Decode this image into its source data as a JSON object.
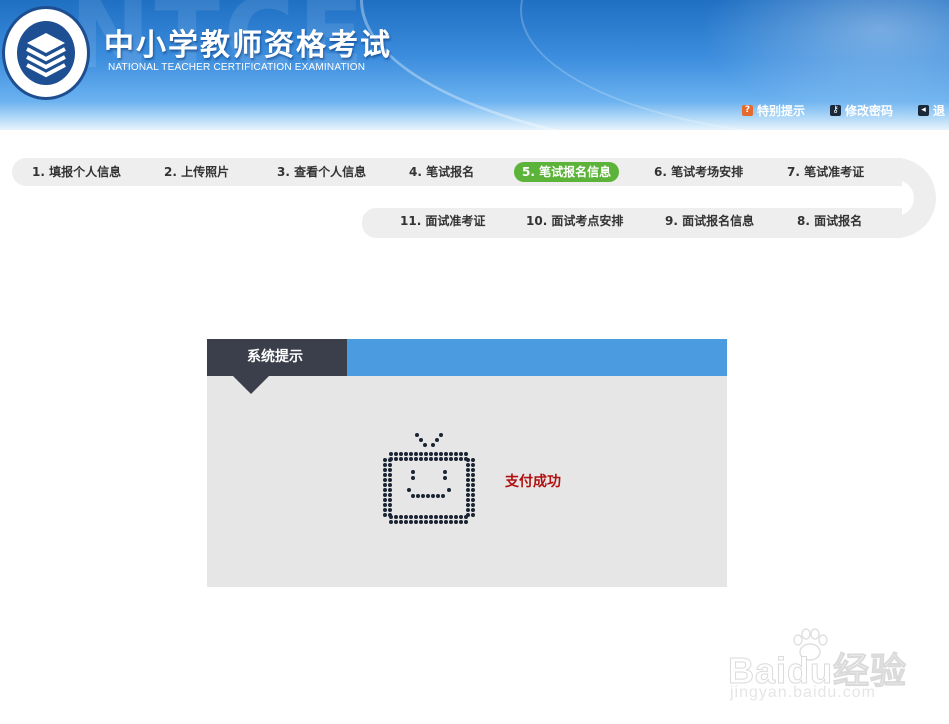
{
  "header": {
    "title": "中小学教师资格考试",
    "subtitle": "NATIONAL TEACHER CERTIFICATION EXAMINATION",
    "watermark_letters": "NTCE",
    "links": [
      {
        "icon": "warning-icon",
        "label": "特别提示"
      },
      {
        "icon": "key-icon",
        "label": "修改密码"
      },
      {
        "icon": "exit-icon",
        "label": "退"
      }
    ]
  },
  "steps": [
    {
      "label": "1. 填报个人信息",
      "active": false
    },
    {
      "label": "2. 上传照片",
      "active": false
    },
    {
      "label": "3. 查看个人信息",
      "active": false
    },
    {
      "label": "4. 笔试报名",
      "active": false
    },
    {
      "label": "5. 笔试报名信息",
      "active": true
    },
    {
      "label": "6. 笔试考场安排",
      "active": false
    },
    {
      "label": "7. 笔试准考证",
      "active": false
    },
    {
      "label": "8. 面试报名",
      "active": false
    },
    {
      "label": "9. 面试报名信息",
      "active": false
    },
    {
      "label": "10. 面试考点安排",
      "active": false
    },
    {
      "label": "11. 面试准考证",
      "active": false
    }
  ],
  "message": {
    "header": "系统提示",
    "text": "支付成功",
    "icon": "tv-smile-icon"
  },
  "watermark": {
    "brand": "Baidu经验",
    "url": "jingyan.baidu.com"
  },
  "colors": {
    "header_blue": "#3d8ede",
    "step_active": "#5cb33a",
    "message_head": "#4a9be0",
    "message_tab": "#3a3f4b",
    "message_text": "#b01010"
  }
}
